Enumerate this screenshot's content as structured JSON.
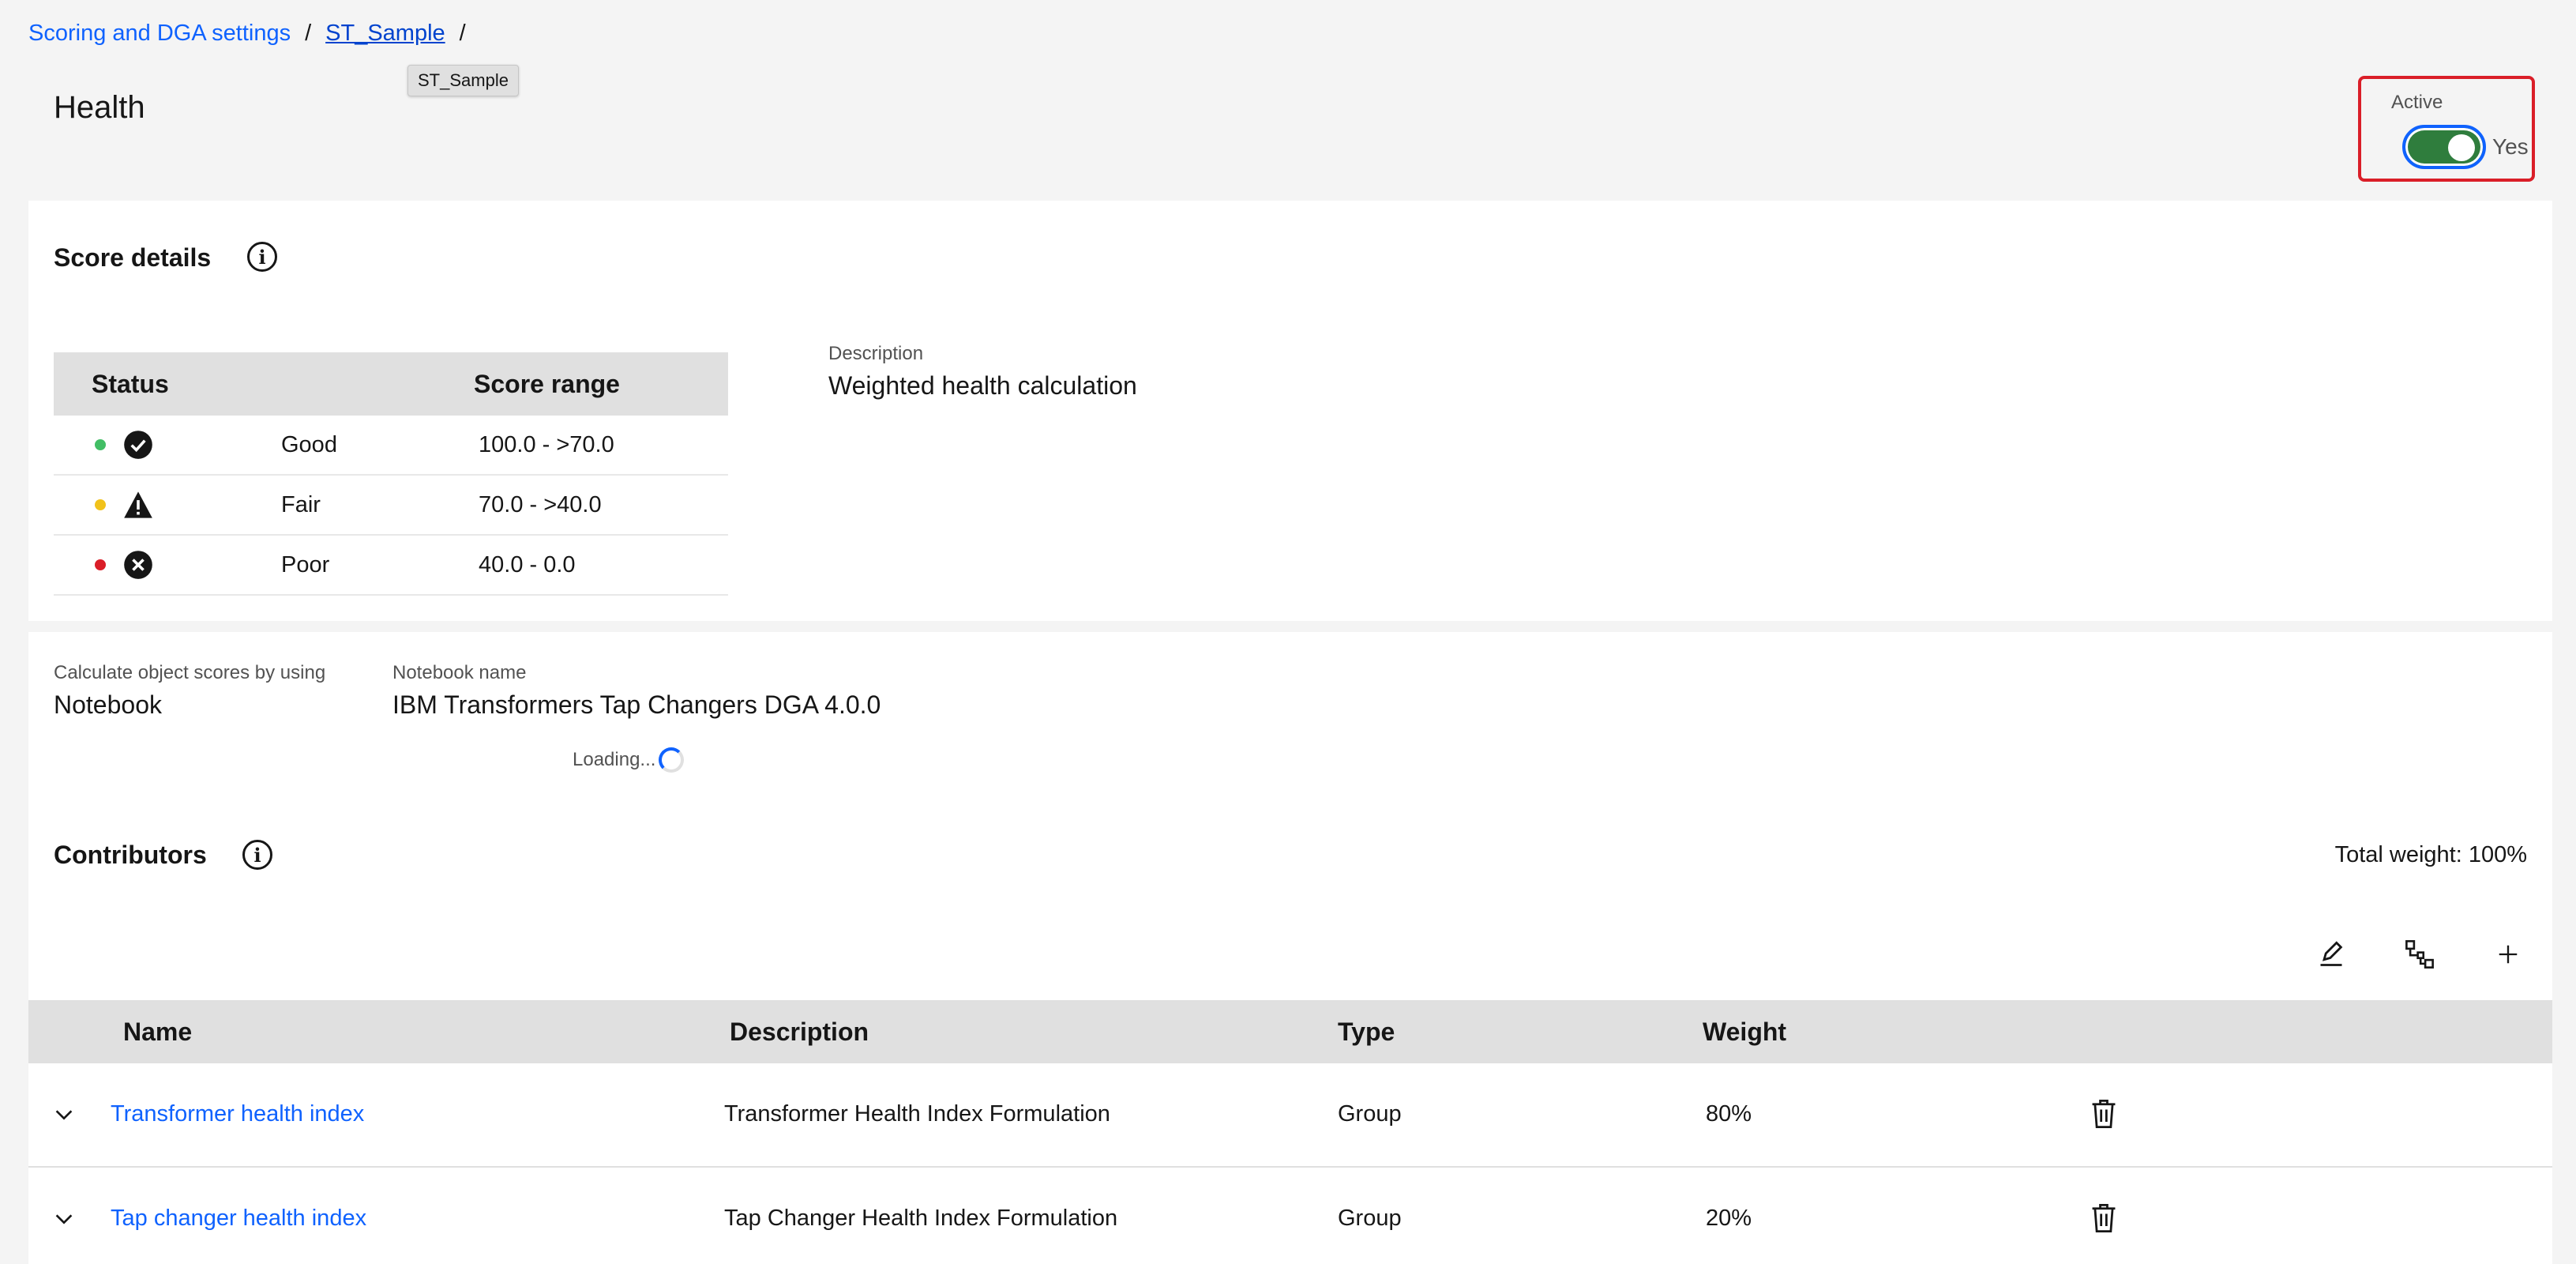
{
  "breadcrumb": {
    "items": [
      "Scoring and DGA settings",
      "ST_Sample"
    ],
    "separator": "/"
  },
  "tooltip": "ST_Sample",
  "page_title": "Health",
  "active_toggle": {
    "label": "Active",
    "state_text": "Yes",
    "on": true
  },
  "score_details": {
    "title": "Score details",
    "table": {
      "headers": {
        "status": "Status",
        "range": "Score range"
      },
      "rows": [
        {
          "label": "Good",
          "range": "100.0 - >70.0",
          "color": "#42be65",
          "icon": "checkmark-filled-icon"
        },
        {
          "label": "Fair",
          "range": "70.0 - >40.0",
          "color": "#f1c21b",
          "icon": "warning-triangle-icon"
        },
        {
          "label": "Poor",
          "range": "40.0 - 0.0",
          "color": "#da1e28",
          "icon": "error-filled-icon"
        }
      ]
    },
    "description_label": "Description",
    "description_value": "Weighted health calculation"
  },
  "calculation": {
    "method_label": "Calculate object scores by using",
    "method_value": "Notebook",
    "notebook_label": "Notebook name",
    "notebook_value": "IBM Transformers Tap Changers DGA 4.0.0",
    "loading_text": "Loading..."
  },
  "contributors": {
    "title": "Contributors",
    "total_weight": "Total weight: 100%",
    "headers": {
      "name": "Name",
      "description": "Description",
      "type": "Type",
      "weight": "Weight"
    },
    "rows": [
      {
        "name": "Transformer health index",
        "description": "Transformer Health Index Formulation",
        "type": "Group",
        "weight": "80%"
      },
      {
        "name": "Tap changer health index",
        "description": "Tap Changer Health Index Formulation",
        "type": "Group",
        "weight": "20%"
      }
    ]
  },
  "colors": {
    "accent": "#0f62fe",
    "toggle_on": "#2f7d3d",
    "highlight": "#da1e28"
  }
}
